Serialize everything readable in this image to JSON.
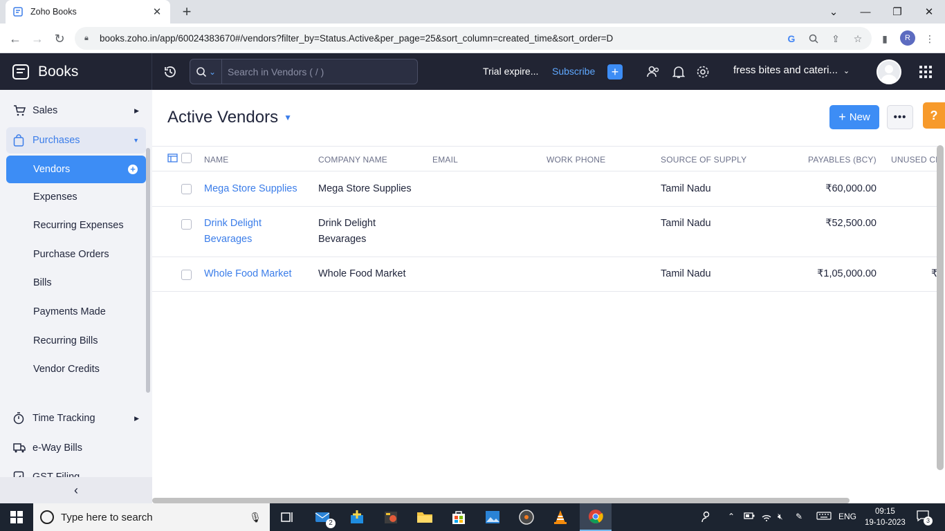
{
  "browser": {
    "tab_title": "Zoho Books",
    "url": "books.zoho.in/app/60024383670#/vendors?filter_by=Status.Active&per_page=25&sort_column=created_time&sort_order=D",
    "profile_initial": "R"
  },
  "header": {
    "brand": "Books",
    "search_placeholder": "Search in Vendors ( / )",
    "trial_text": "Trial expire...",
    "subscribe_label": "Subscribe",
    "org_name": "fress bites and cateri..."
  },
  "sidebar": {
    "items": [
      {
        "label": "Sales"
      },
      {
        "label": "Purchases"
      },
      {
        "label": "Time Tracking"
      },
      {
        "label": "e-Way Bills"
      },
      {
        "label": "GST Filing"
      }
    ],
    "purchases_sub": [
      {
        "label": "Vendors"
      },
      {
        "label": "Expenses"
      },
      {
        "label": "Recurring Expenses"
      },
      {
        "label": "Purchase Orders"
      },
      {
        "label": "Bills"
      },
      {
        "label": "Payments Made"
      },
      {
        "label": "Recurring Bills"
      },
      {
        "label": "Vendor Credits"
      }
    ]
  },
  "main": {
    "title": "Active Vendors",
    "new_label": "New",
    "help_label": "?",
    "columns": [
      "NAME",
      "COMPANY NAME",
      "EMAIL",
      "WORK PHONE",
      "SOURCE OF SUPPLY",
      "PAYABLES (BCY)",
      "UNUSED CR"
    ],
    "rows": [
      {
        "name_line1": "Mega Store Supplies",
        "name_line2": "",
        "company_line1": "Mega Store Supplies",
        "company_line2": "",
        "email": "",
        "phone": "",
        "source": "Tamil Nadu",
        "payables": "₹60,000.00",
        "unused": ""
      },
      {
        "name_line1": "Drink Delight",
        "name_line2": "Bevarages",
        "company_line1": "Drink Delight",
        "company_line2": "Bevarages",
        "email": "",
        "phone": "",
        "source": "Tamil Nadu",
        "payables": "₹52,500.00",
        "unused": ""
      },
      {
        "name_line1": "Whole Food Market",
        "name_line2": "",
        "company_line1": "Whole Food Market",
        "company_line2": "",
        "email": "",
        "phone": "",
        "source": "Tamil Nadu",
        "payables": "₹1,05,000.00",
        "unused": "₹"
      }
    ]
  },
  "taskbar": {
    "search_placeholder": "Type here to search",
    "mail_badge": "2",
    "language": "ENG",
    "time": "09:15",
    "date": "19-10-2023",
    "notification_count": "3"
  },
  "colors": {
    "accent": "#3d8df5",
    "header_bg": "#212433",
    "sidebar_bg": "#f2f3f7",
    "help": "#f79a2b"
  }
}
